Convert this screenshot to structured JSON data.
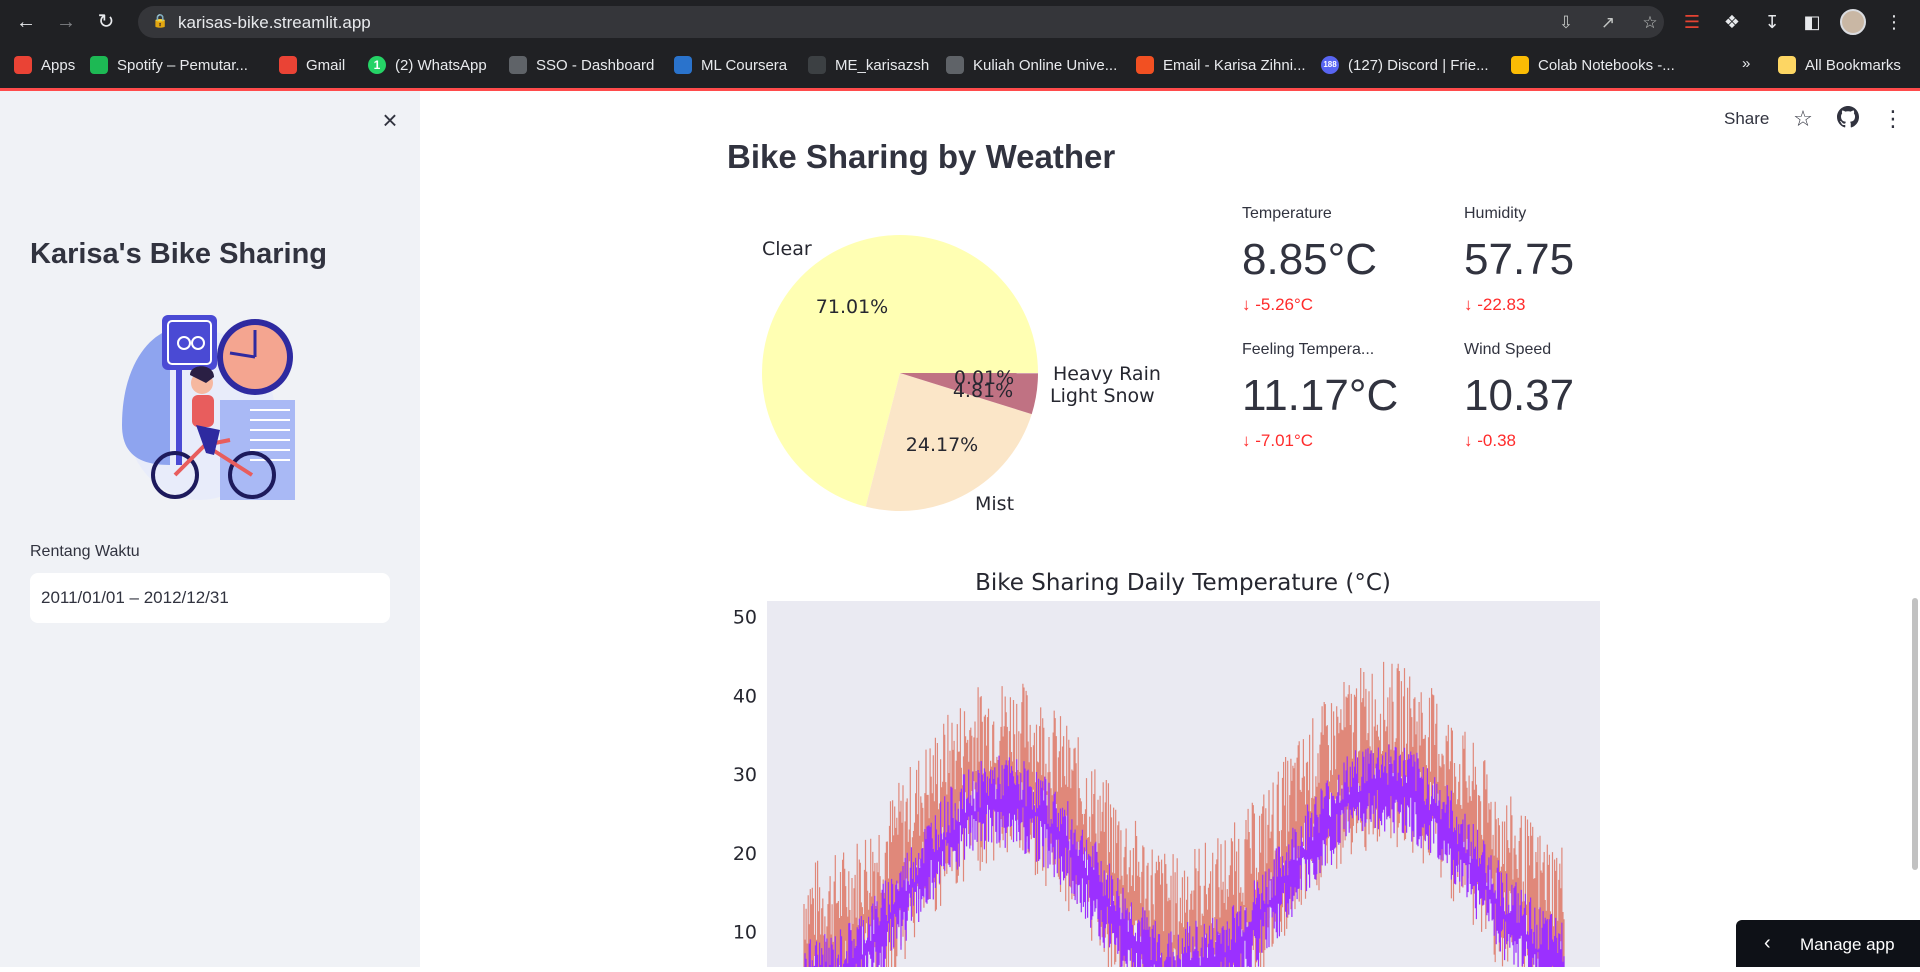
{
  "browser": {
    "url": "karisas-bike.streamlit.app",
    "bookmarks": [
      {
        "label": "Apps",
        "color": "#ea4335"
      },
      {
        "label": "Spotify – Pemutar...",
        "color": "#1db954"
      },
      {
        "label": "Gmail",
        "color": "#ea4335"
      },
      {
        "label": "(2) WhatsApp",
        "color": "#25d366"
      },
      {
        "label": "SSO - Dashboard",
        "color": "#5f6368"
      },
      {
        "label": "ML Coursera",
        "color": "#2a73cc"
      },
      {
        "label": "ME_karisazsh",
        "color": "#3c4043"
      },
      {
        "label": "Kuliah Online Unive...",
        "color": "#5f6368"
      },
      {
        "label": "Email - Karisa Zihni...",
        "color": "#f25022"
      },
      {
        "label": "(127) Discord | Frie...",
        "color": "#5865f2"
      },
      {
        "label": "Colab Notebooks -...",
        "color": "#fbbc04"
      }
    ],
    "bookmarks_more": "»",
    "all_bookmarks": "All Bookmarks",
    "whatsapp_badge": "1",
    "discord_badge": "188"
  },
  "sidebar": {
    "title": "Karisa's Bike Sharing",
    "date_label": "Rentang Waktu",
    "date_value": "2011/01/01 – 2012/12/31"
  },
  "header": {
    "share": "Share"
  },
  "main": {
    "section_title": "Bike Sharing by Weather",
    "metrics": [
      {
        "label": "Temperature",
        "value": "8.85°C",
        "delta": "-5.26°C"
      },
      {
        "label": "Humidity",
        "value": "57.75",
        "delta": "-22.83"
      },
      {
        "label": "Feeling Tempera...",
        "value": "11.17°C",
        "delta": "-7.01°C"
      },
      {
        "label": "Wind Speed",
        "value": "10.37",
        "delta": "-0.38"
      }
    ]
  },
  "manage_app": "Manage app",
  "chart_data": [
    {
      "type": "pie",
      "title": "",
      "categories": [
        "Clear",
        "Mist",
        "Light Snow",
        "Heavy Rain"
      ],
      "values": [
        71.01,
        24.17,
        4.81,
        0.01
      ],
      "labels": [
        "71.01%",
        "24.17%",
        "4.81%",
        "0.01%"
      ],
      "colors": [
        "#ffffb3",
        "#fbe6c8",
        "#c07283",
        "#8b2f5f"
      ]
    },
    {
      "type": "line",
      "title": "Bike Sharing Daily Temperature (°C)",
      "xlabel": "",
      "ylabel": "",
      "ylim": [
        5,
        52
      ],
      "yticks": [
        10,
        20,
        30,
        40,
        50
      ],
      "grid": false,
      "series": [
        {
          "color": "#e0887a"
        },
        {
          "color": "#9b30ff"
        }
      ]
    }
  ]
}
